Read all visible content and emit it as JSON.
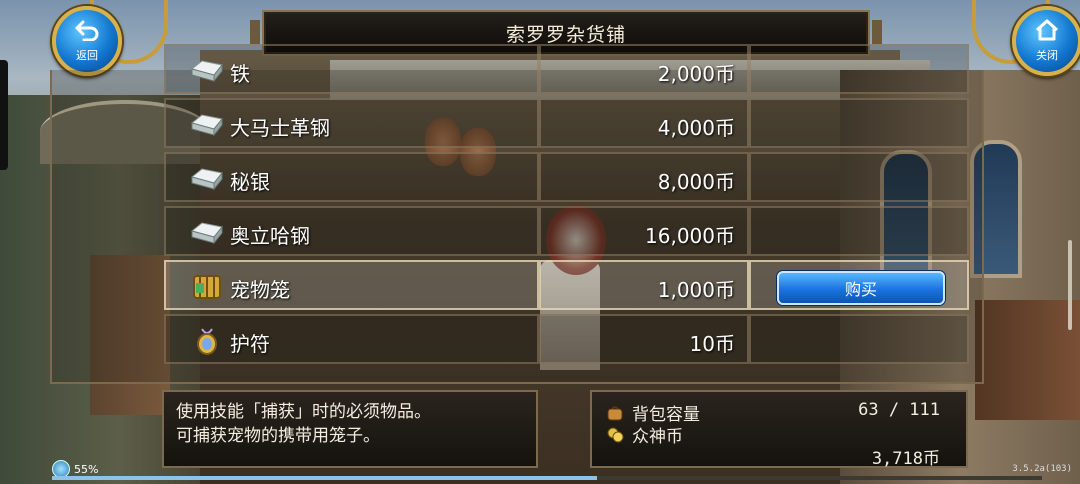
{
  "window": {
    "title": "索罗罗杂货铺"
  },
  "nav": {
    "back_label": "返回",
    "close_label": "关闭"
  },
  "shop": {
    "items": [
      {
        "name": "铁",
        "price": "2,000币",
        "icon": "ingot-icon"
      },
      {
        "name": "大马士革钢",
        "price": "4,000币",
        "icon": "ingot-icon"
      },
      {
        "name": "秘银",
        "price": "8,000币",
        "icon": "ingot-icon"
      },
      {
        "name": "奥立哈钢",
        "price": "16,000币",
        "icon": "ingot-icon"
      },
      {
        "name": "宠物笼",
        "price": "1,000币",
        "icon": "pet-cage-icon",
        "selected": true
      },
      {
        "name": "护符",
        "price": "10币",
        "icon": "amulet-icon"
      }
    ],
    "buy_label": "购买"
  },
  "description": {
    "line1": "使用技能「捕获」时的必须物品。",
    "line2": "可捕获宠物的携带用笼子。"
  },
  "inventory": {
    "bag_label": "背包容量",
    "bag_value": "63 / 111",
    "coin_label": "众神币",
    "coin_value": "3,718币"
  },
  "status": {
    "battery": "55%",
    "battery_fraction": 0.55,
    "version": "3.5.2a(103)"
  },
  "colors": {
    "accent": "#1a73e0",
    "gold": "#d7b24c",
    "panel_border": "#7d6a4e"
  }
}
